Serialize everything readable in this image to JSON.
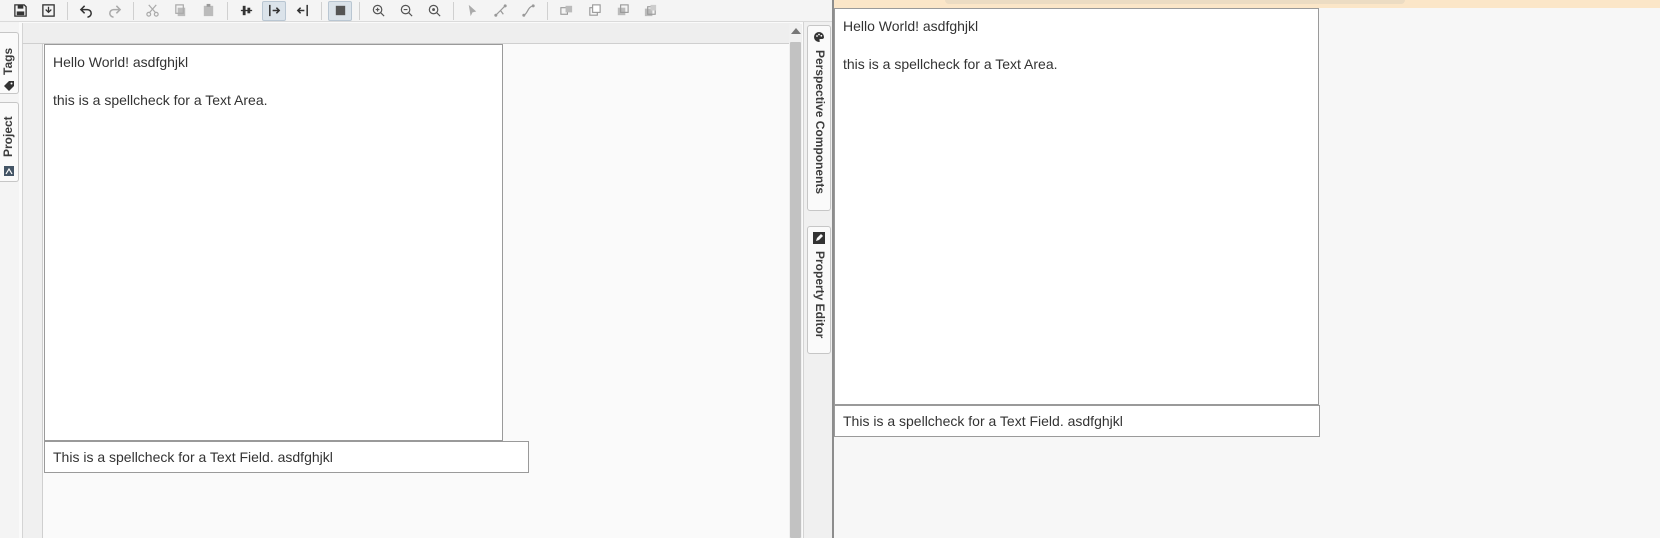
{
  "toolbar": {
    "icons": [
      "save-icon",
      "save-all-icon",
      "undo-icon",
      "redo-icon",
      "cut-icon",
      "copy-icon",
      "paste-icon",
      "align-icon",
      "align-left-icon",
      "align-right-icon",
      "stop-icon",
      "zoom-in-icon",
      "zoom-out-icon",
      "zoom-fit-icon",
      "select-icon",
      "edit-points-icon",
      "connect-icon",
      "group-icon",
      "bring-front-icon",
      "send-back-icon",
      "layers-icon"
    ]
  },
  "left_dock": {
    "tabs": [
      {
        "label": "Tags",
        "icon": "tag-icon"
      },
      {
        "label": "Project",
        "icon": "project-icon"
      }
    ]
  },
  "right_dock": {
    "tabs": [
      {
        "label": "Perspective Components",
        "icon": "palette-icon"
      },
      {
        "label": "Property Editor",
        "icon": "pencil-icon"
      }
    ]
  },
  "designer_view": {
    "text_area": {
      "lines": [
        "Hello World! asdfghjkl",
        "this is a spellcheck for a Text Area."
      ]
    },
    "text_field": {
      "value": "This is a spellcheck for a Text Field. asdfghjkl"
    }
  },
  "session_view": {
    "text_area": {
      "lines": [
        "Hello World! asdfghjkl",
        "this is a spellcheck for a Text Area."
      ]
    },
    "text_field": {
      "value": "This is a spellcheck for a Text Field. asdfghjkl"
    }
  },
  "colors": {
    "session_header": "#fbe6c8",
    "active_tool": "#dbe3ea",
    "divider": "#8d8d8d"
  }
}
